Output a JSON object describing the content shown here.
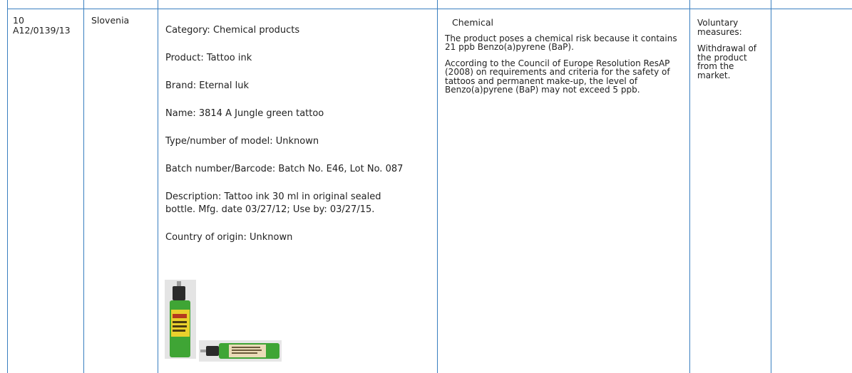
{
  "row": {
    "number": "10",
    "reference": "A12/0139/13",
    "country": "Slovenia",
    "product_lines": [
      "Category: Chemical products",
      "Product: Tattoo ink",
      "Brand: Eternal luk",
      "Name: 3814 A Jungle green tattoo",
      "Type/number of model: Unknown",
      "Batch number/Barcode: Batch No. E46, Lot No. 087"
    ],
    "description_line1": "Description: Tattoo ink 30 ml in original sealed",
    "description_line2": "bottle. Mfg. date 03/27/12; Use by: 03/27/15.",
    "origin": "Country of origin: Unknown",
    "risk_type": "Chemical",
    "risk_text_1": "The product poses a chemical risk because it contains 21 ppb Benzo(a)pyrene (BaP).",
    "risk_text_2": "According to the Council of Europe Resolution ResAP (2008) on requirements and criteria for the safety of tattoos and permanent make-up, the level of Benzo(a)pyrene (BaP) may not exceed 5 ppb.",
    "measures_title": "Voluntary measures:",
    "measures_text": "Withdrawal of the product from the market."
  },
  "colors": {
    "border": "#3a7fc0",
    "ink_green": "#3fa535",
    "bottle_dark": "#2b2b2b"
  },
  "images": [
    "tattoo-ink-bottle-upright-photo",
    "tattoo-ink-bottle-lying-photo"
  ]
}
